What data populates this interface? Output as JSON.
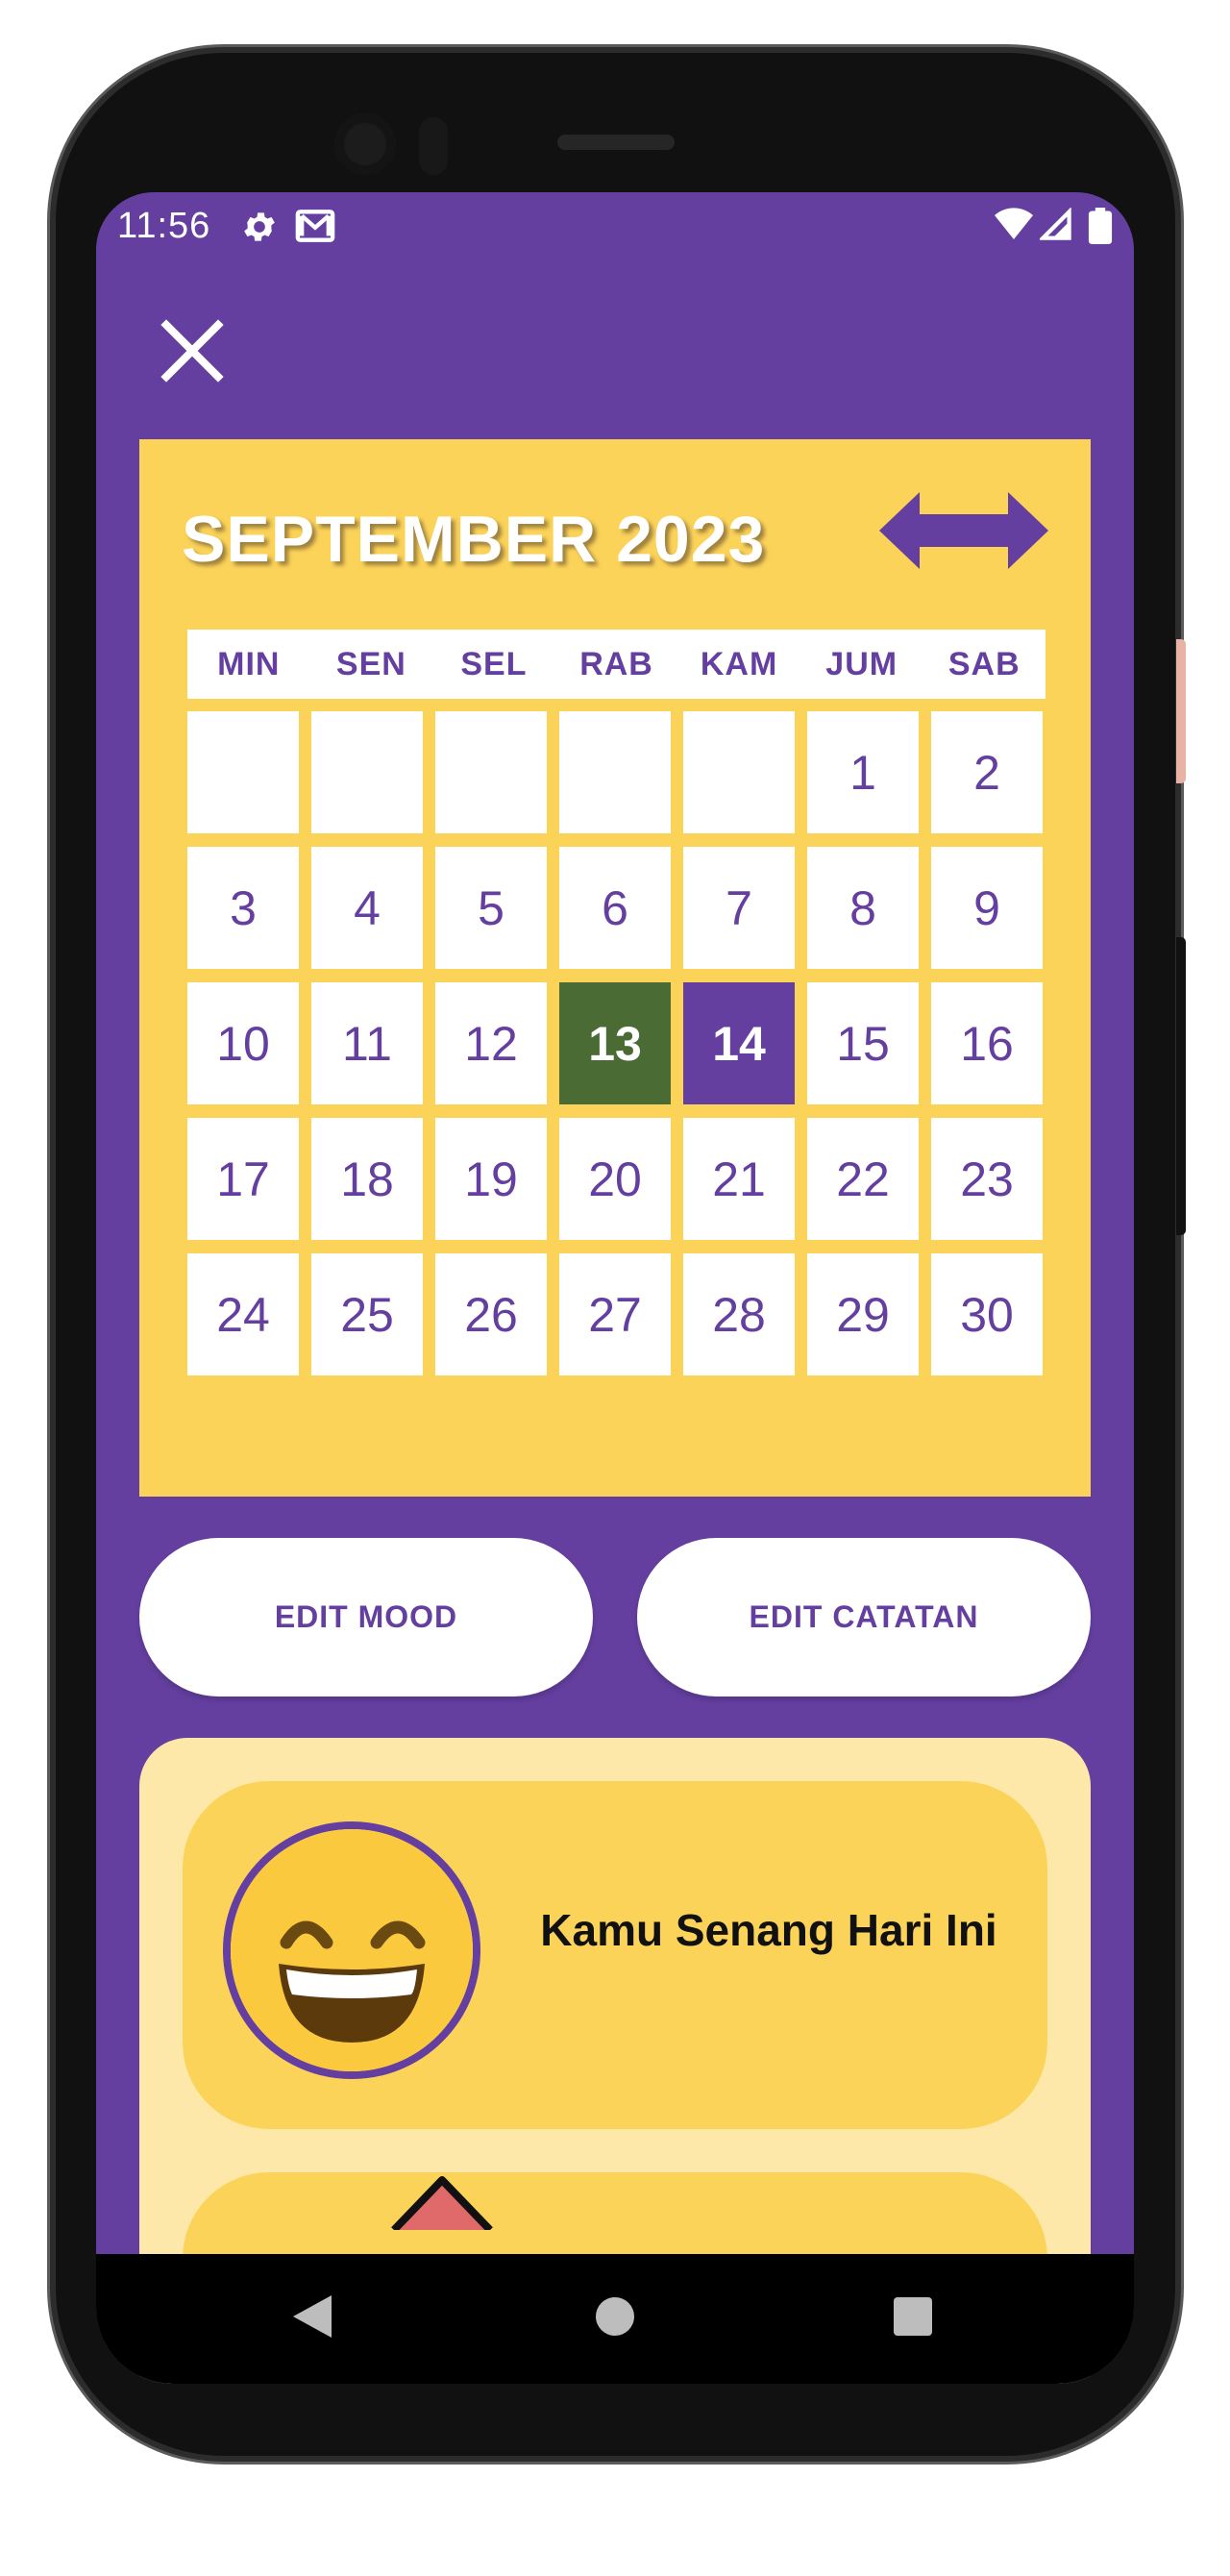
{
  "status_bar": {
    "time": "11:56",
    "icons": [
      "settings-icon",
      "gmail-icon",
      "wifi-icon",
      "signal-icon",
      "battery-icon"
    ]
  },
  "toolbar": {
    "close_icon": "close-icon"
  },
  "calendar": {
    "month_title": "SEPTEMBER 2023",
    "weekdays": [
      "MIN",
      "SEN",
      "SEL",
      "RAB",
      "KAM",
      "JUM",
      "SAB"
    ],
    "days": [
      [
        "",
        "",
        "",
        "",
        "",
        "1",
        "2"
      ],
      [
        "3",
        "4",
        "5",
        "6",
        "7",
        "8",
        "9"
      ],
      [
        "10",
        "11",
        "12",
        "13",
        "14",
        "15",
        "16"
      ],
      [
        "17",
        "18",
        "19",
        "20",
        "21",
        "22",
        "23"
      ],
      [
        "24",
        "25",
        "26",
        "27",
        "28",
        "29",
        "30"
      ]
    ],
    "selected_green": "13",
    "selected_purple": "14",
    "colors": {
      "background": "#fcd359",
      "accent": "#643fa0",
      "green": "#4a6b34"
    }
  },
  "buttons": {
    "edit_mood": "EDIT MOOD",
    "edit_note": "EDIT CATATAN"
  },
  "mood": {
    "emoji_icon": "grinning-face-icon",
    "text": "Kamu Senang Hari Ini"
  },
  "nav_bar": {
    "icons": [
      "back-icon",
      "home-icon",
      "recents-icon"
    ]
  }
}
